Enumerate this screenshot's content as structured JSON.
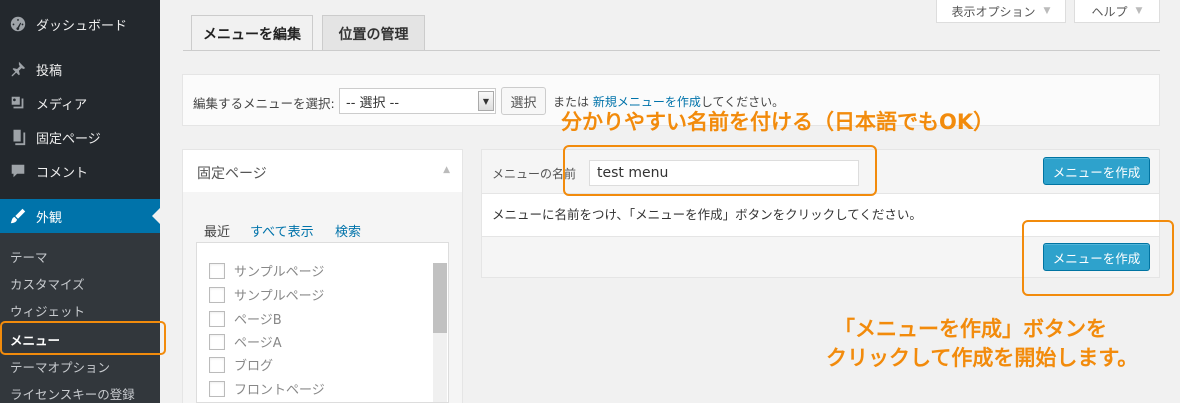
{
  "sidebar": {
    "items": [
      {
        "label": "ダッシュボード",
        "icon": "dashboard-icon"
      },
      {
        "label": "投稿",
        "icon": "pin-icon"
      },
      {
        "label": "メディア",
        "icon": "media-icon"
      },
      {
        "label": "固定ページ",
        "icon": "pages-icon"
      },
      {
        "label": "コメント",
        "icon": "comment-icon"
      },
      {
        "label": "外観",
        "icon": "appearance-brush-icon"
      }
    ],
    "submenu": [
      "テーマ",
      "カスタマイズ",
      "ウィジェット",
      "メニュー",
      "テーマオプション",
      "ライセンスキーの登録"
    ]
  },
  "screen_options": {
    "label": "表示オプション",
    "help": "ヘルプ"
  },
  "tabs": {
    "edit": "メニューを編集",
    "locations": "位置の管理"
  },
  "select_bar": {
    "label": "編集するメニューを選択:",
    "select_value": "-- 選択 --",
    "select_button": "選択",
    "or_text": "または",
    "create_link": "新規メニューを作成",
    "suffix": "してください。"
  },
  "pages_box": {
    "title": "固定ページ",
    "tabs": [
      "最近",
      "すべて表示",
      "検索"
    ],
    "pages": [
      "サンプルページ",
      "サンプルページ",
      "ページB",
      "ページA",
      "ブログ",
      "フロントページ"
    ]
  },
  "edit_box": {
    "name_label": "メニューの名前",
    "name_value": "test menu",
    "create_button": "メニューを作成",
    "instruction": "メニューに名前をつけ、「メニューを作成」ボタンをクリックしてください。"
  },
  "annotations": {
    "name_tip": "分かりやすい名前を付ける（日本語でもOK）",
    "button_tip_line1": "「メニューを作成」ボタンを",
    "button_tip_line2": "クリックして作成を開始します。"
  },
  "colors": {
    "sidebar_bg": "#23282d",
    "submenu_bg": "#32373c",
    "active_blue": "#0073aa",
    "button_blue": "#2ea2cc",
    "annotation_orange": "#f28b0c"
  }
}
